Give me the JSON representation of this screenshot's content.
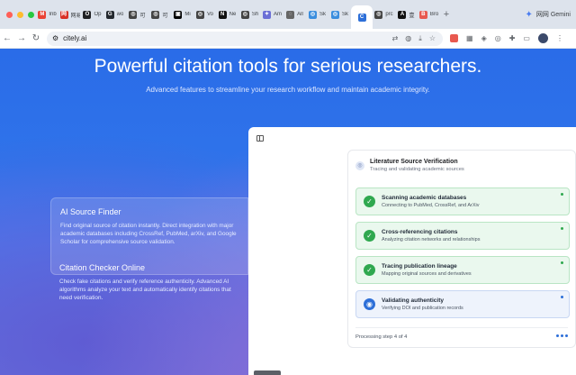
{
  "browser": {
    "tabs": [
      {
        "label": "Inb",
        "icon": "gmail-icon",
        "color": "#ea4335",
        "glyph": "M"
      },
      {
        "label": "网易",
        "icon": "netease-icon",
        "color": "#d93025",
        "glyph": "网"
      },
      {
        "label": "Op",
        "icon": "openai-icon",
        "color": "#202124",
        "glyph": "O"
      },
      {
        "label": "wo",
        "icon": "github-icon",
        "color": "#24292f",
        "glyph": "G"
      },
      {
        "label": "可",
        "icon": "app-icon",
        "color": "#444444",
        "glyph": "◎"
      },
      {
        "label": "可",
        "icon": "app-icon",
        "color": "#444444",
        "glyph": "◎"
      },
      {
        "label": "Mi",
        "icon": "app-icon",
        "color": "#000000",
        "glyph": "▣"
      },
      {
        "label": "Vo",
        "icon": "app-icon",
        "color": "#444444",
        "glyph": "◎"
      },
      {
        "label": "Ne",
        "icon": "notion-icon",
        "color": "#111111",
        "glyph": "N"
      },
      {
        "label": "Sh",
        "icon": "app-icon",
        "color": "#444444",
        "glyph": "◎"
      },
      {
        "label": "Am",
        "icon": "star-icon",
        "color": "#6b6fd6",
        "glyph": "✦"
      },
      {
        "label": "All",
        "icon": "app-icon",
        "color": "#666666",
        "glyph": "◌"
      },
      {
        "label": "Sk",
        "icon": "app-icon",
        "color": "#3b8ede",
        "glyph": "◎"
      },
      {
        "label": "Sk",
        "icon": "app-icon",
        "color": "#3b8ede",
        "glyph": "◎"
      },
      {
        "label": "",
        "icon": "citely-icon",
        "color": "#2d6fd8",
        "glyph": "C",
        "active": true
      },
      {
        "label": "prc",
        "icon": "app-icon",
        "color": "#444444",
        "glyph": "◎"
      },
      {
        "label": "壹",
        "icon": "app-icon",
        "color": "#111111",
        "glyph": "A"
      },
      {
        "label": "Bro",
        "icon": "app-icon",
        "color": "#e8594f",
        "glyph": "B"
      }
    ],
    "new_tab": "+",
    "gemini_label": "网网 Gemini",
    "url": "citely.ai"
  },
  "hero": {
    "title": "Powerful citation tools for serious researchers.",
    "subtitle": "Advanced features to streamline your research workflow and maintain academic integrity."
  },
  "features": [
    {
      "title": "AI Source Finder",
      "body": "Find original source of citation instantly. Direct integration with major academic databases including CrossRef, PubMed, arXiv, and Google Scholar for comprehensive source validation."
    },
    {
      "title": "Citation Checker Online",
      "body": "Check fake citations and verify reference authenticity. Advanced AI algorithms analyze your text and automatically identify citations that need verification."
    }
  ],
  "panel": {
    "title": "Literature Source Verification",
    "subtitle": "Tracing and validating academic sources",
    "steps": [
      {
        "title": "Scanning academic databases",
        "desc": "Connecting to PubMed, CrossRef, and ArXiv",
        "status": "done"
      },
      {
        "title": "Cross-referencing citations",
        "desc": "Analyzing citation networks and relationships",
        "status": "done"
      },
      {
        "title": "Tracing publication lineage",
        "desc": "Mapping original sources and derivatives",
        "status": "done"
      },
      {
        "title": "Validating authenticity",
        "desc": "Verifying DOI and publication records",
        "status": "active"
      }
    ],
    "footer": "Processing step 4 of 4"
  }
}
